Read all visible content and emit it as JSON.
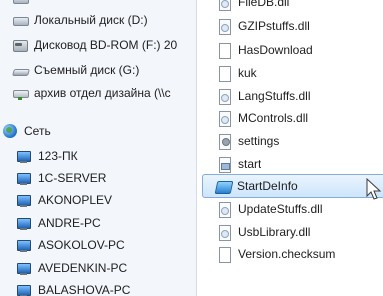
{
  "nav_pane": {
    "items": [
      {
        "label": "Локальный диск (D:)",
        "icon": "drive-icon"
      },
      {
        "label": "Дисковод BD-ROM (F:) 20",
        "icon": "bd-rom-icon"
      },
      {
        "label": "Съемный диск (G:)",
        "icon": "removable-disk-icon"
      },
      {
        "label": "архив отдел дизайна (\\\\c",
        "icon": "network-share-icon"
      }
    ],
    "network": {
      "label": "Сеть",
      "icon": "network-icon",
      "computers": [
        "123-ПК",
        "1C-SERVER",
        "AKONOPLEV",
        "ANDRE-PC",
        "ASOKOLOV-PC",
        "AVEDENKIN-PC",
        "BALASHOVA-PC"
      ]
    }
  },
  "file_list": {
    "items": [
      {
        "name": "FileDB.dll",
        "type": "dll"
      },
      {
        "name": "GZIPstuffs.dll",
        "type": "dll"
      },
      {
        "name": "HasDownload",
        "type": "file"
      },
      {
        "name": "kuk",
        "type": "file"
      },
      {
        "name": "LangStuffs.dll",
        "type": "dll"
      },
      {
        "name": "MControls.dll",
        "type": "dll"
      },
      {
        "name": "settings",
        "type": "settings"
      },
      {
        "name": "start",
        "type": "batch"
      },
      {
        "name": "StartDeInfo",
        "type": "folder-shortcut",
        "selected": true
      },
      {
        "name": "UpdateStuffs.dll",
        "type": "dll"
      },
      {
        "name": "UsbLibrary.dll",
        "type": "dll"
      },
      {
        "name": "Version.checksum",
        "type": "file"
      }
    ]
  },
  "colors": {
    "selection_bg": "#cde5fb",
    "selection_border": "#84acdd",
    "nav_bg": "#f3f6fb"
  }
}
